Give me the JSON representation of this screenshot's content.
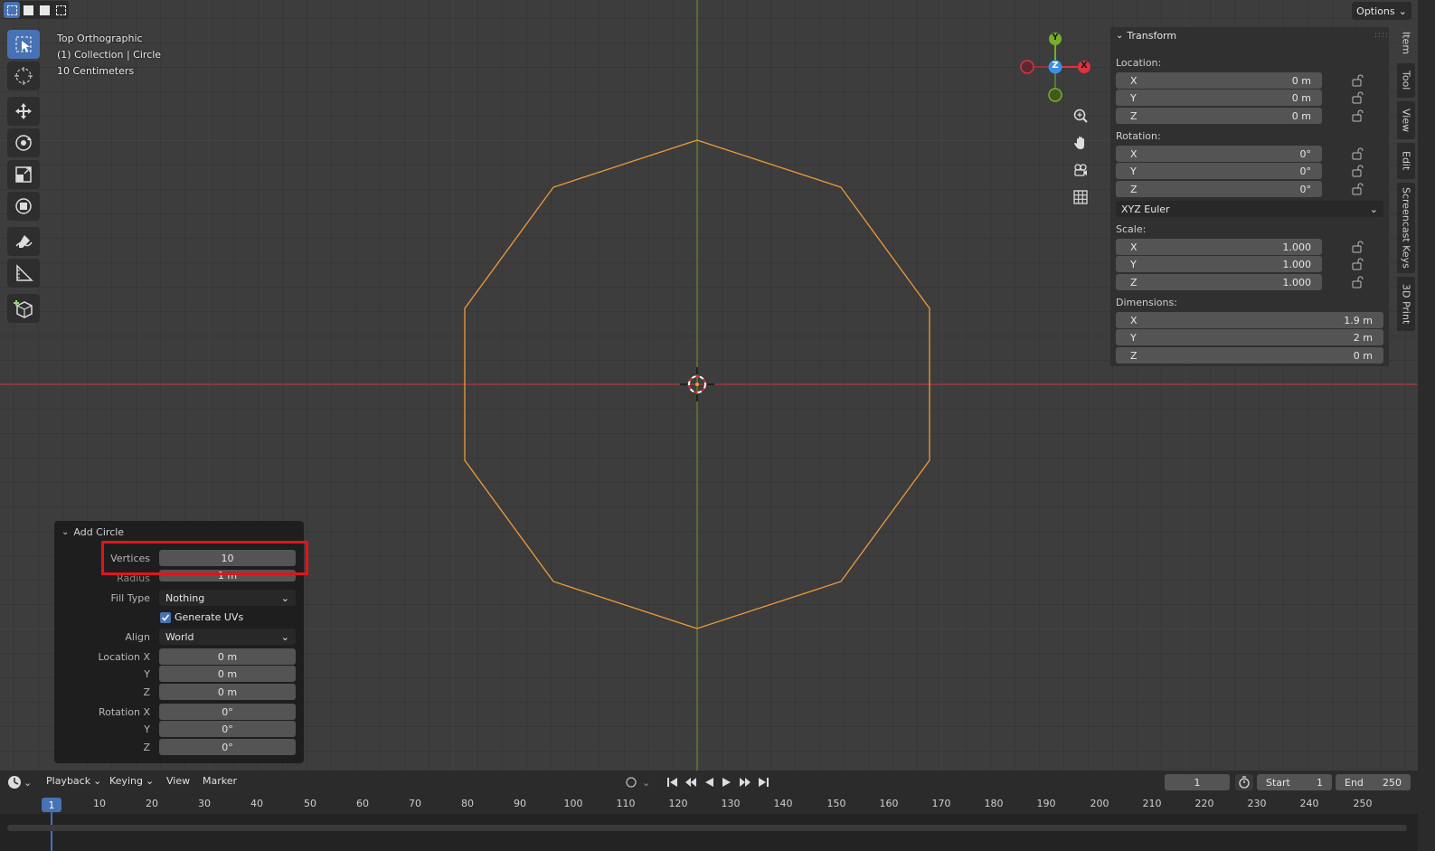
{
  "header": {
    "selection_modes": [
      "select-box-new",
      "select-box-extend",
      "select-box-subtract",
      "select-box-intersect"
    ],
    "options_label": "Options"
  },
  "toolbar": {
    "tools": [
      "select-box",
      "cursor",
      "move",
      "rotate",
      "scale",
      "transform",
      "annotate",
      "measure",
      "add-cube"
    ]
  },
  "viewport": {
    "view_name": "Top Orthographic",
    "collection_info": "(1) Collection | Circle",
    "grid_scale": "10 Centimeters",
    "object_color": "#f09a3a",
    "x_axis_color": "#d6323c",
    "y_axis_color": "#7fae1c"
  },
  "gizmo": {
    "y_label": "Y",
    "z_label": "Z",
    "x_label": "X",
    "x_color": "#e0313f",
    "y_color": "#74b025",
    "z_color": "#3d8fe6"
  },
  "sidebar": {
    "panel_title": "Transform",
    "location_label": "Location:",
    "location": [
      {
        "axis": "X",
        "value": "0 m"
      },
      {
        "axis": "Y",
        "value": "0 m"
      },
      {
        "axis": "Z",
        "value": "0 m"
      }
    ],
    "rotation_label": "Rotation:",
    "rotation": [
      {
        "axis": "X",
        "value": "0°"
      },
      {
        "axis": "Y",
        "value": "0°"
      },
      {
        "axis": "Z",
        "value": "0°"
      }
    ],
    "rotation_mode": "XYZ Euler",
    "scale_label": "Scale:",
    "scale": [
      {
        "axis": "X",
        "value": "1.000"
      },
      {
        "axis": "Y",
        "value": "1.000"
      },
      {
        "axis": "Z",
        "value": "1.000"
      }
    ],
    "dimensions_label": "Dimensions:",
    "dimensions": [
      {
        "axis": "X",
        "value": "1.9 m"
      },
      {
        "axis": "Y",
        "value": "2 m"
      },
      {
        "axis": "Z",
        "value": "0 m"
      }
    ],
    "tabs": [
      "Item",
      "Tool",
      "View",
      "Edit",
      "Screencast Keys",
      "3D Print"
    ]
  },
  "operator_panel": {
    "title": "Add Circle",
    "vertices_label": "Vertices",
    "vertices_value": "10",
    "radius_label": "Radius",
    "radius_value": "1 m",
    "fill_type_label": "Fill Type",
    "fill_type_value": "Nothing",
    "generate_uvs_label": "Generate UVs",
    "generate_uvs_checked": true,
    "align_label": "Align",
    "align_value": "World",
    "location_x_label": "Location X",
    "location_x_value": "0 m",
    "location_y_label": "Y",
    "location_y_value": "0 m",
    "location_z_label": "Z",
    "location_z_value": "0 m",
    "rotation_x_label": "Rotation X",
    "rotation_x_value": "0°",
    "rotation_y_label": "Y",
    "rotation_y_value": "0°",
    "rotation_z_label": "Z",
    "rotation_z_value": "0°"
  },
  "timeline": {
    "menus": [
      "Playback",
      "Keying",
      "View",
      "Marker"
    ],
    "current_frame": "1",
    "start_label": "Start",
    "start_value": "1",
    "end_label": "End",
    "end_value": "250",
    "frame_ticks": [
      "10",
      "20",
      "30",
      "40",
      "50",
      "60",
      "70",
      "80",
      "90",
      "100",
      "110",
      "120",
      "130",
      "140",
      "150",
      "160",
      "170",
      "180",
      "190",
      "200",
      "210",
      "220",
      "230",
      "240",
      "250"
    ],
    "playhead_frame": "1"
  }
}
